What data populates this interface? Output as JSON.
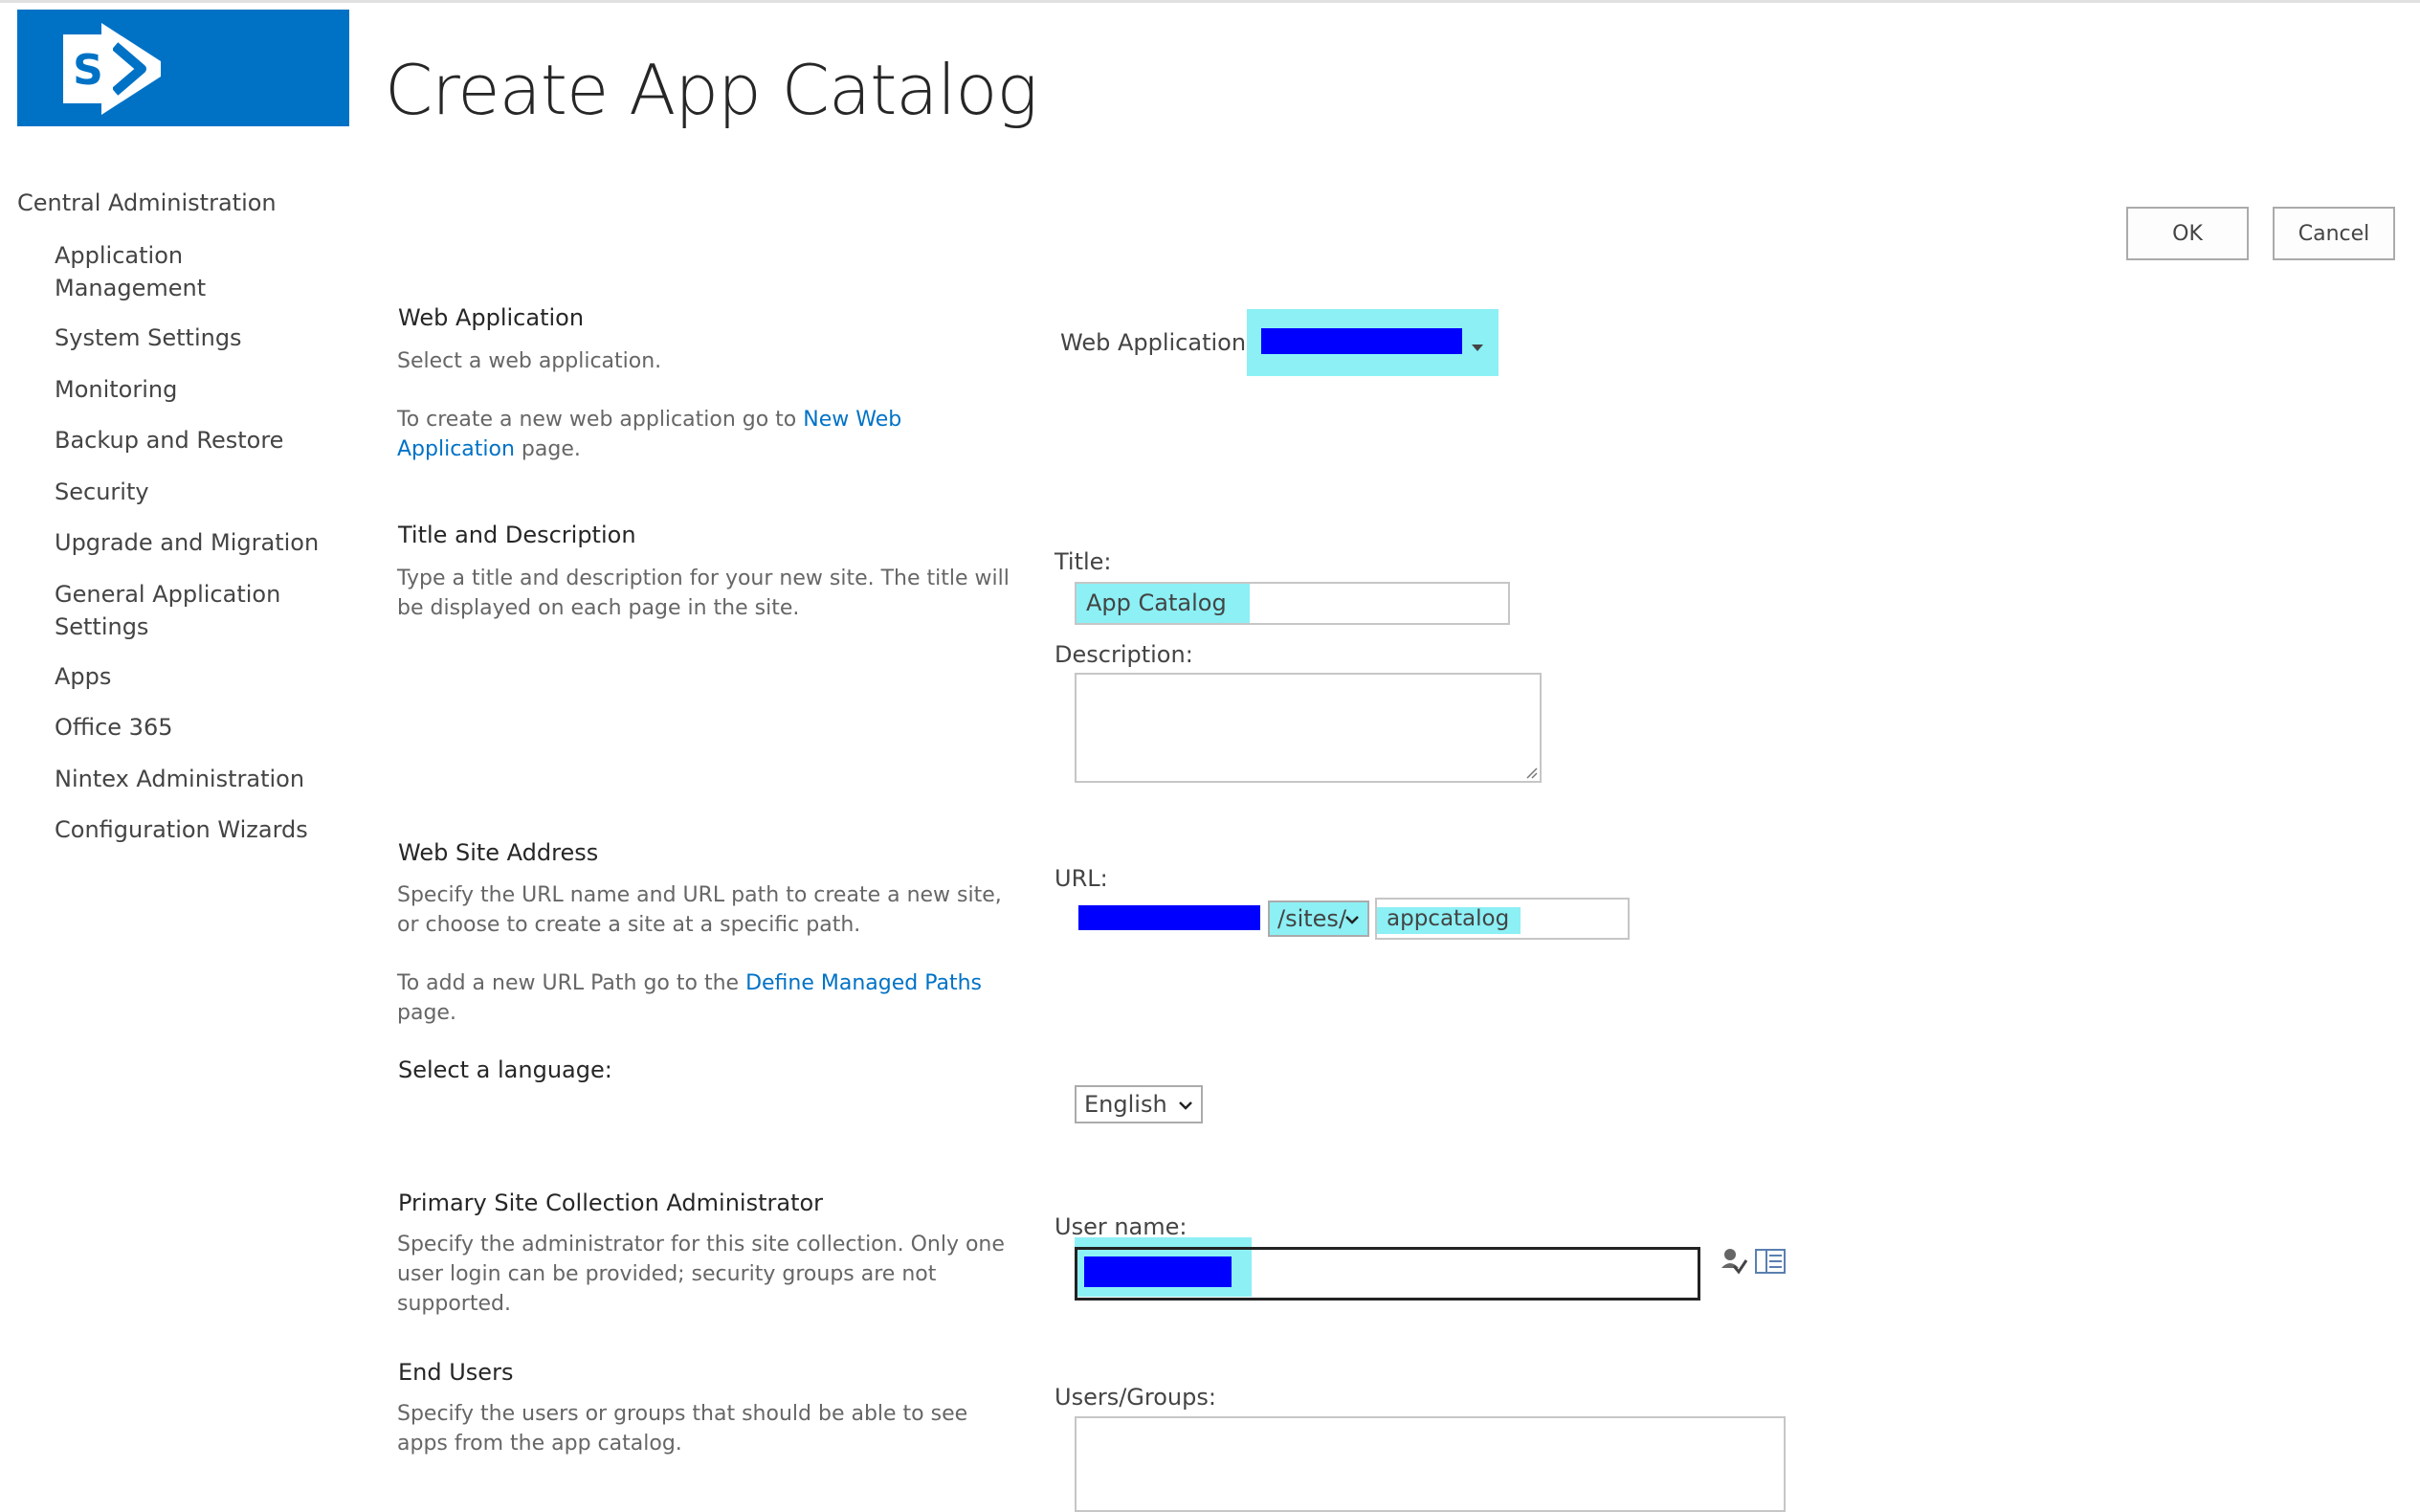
{
  "page": {
    "title": "Create App Catalog"
  },
  "nav": {
    "root": "Central Administration",
    "items": [
      "Application Management",
      "System Settings",
      "Monitoring",
      "Backup and Restore",
      "Security",
      "Upgrade and Migration",
      "General Application Settings",
      "Apps",
      "Office 365",
      "Nintex Administration",
      "Configuration Wizards"
    ]
  },
  "buttons": {
    "ok": "OK",
    "cancel": "Cancel"
  },
  "sections": {
    "web_application": {
      "heading": "Web Application",
      "desc": "Select a web application.",
      "desc2_prefix": "To create a new web application go to ",
      "desc2_link": "New Web Application",
      "desc2_suffix": " page.",
      "field_label": "Web Application:"
    },
    "title_description": {
      "heading": "Title and Description",
      "desc": "Type a title and description for your new site. The title will be displayed on each page in the site.",
      "title_label": "Title:",
      "title_value": "App Catalog",
      "description_label": "Description:",
      "description_value": ""
    },
    "web_site_address": {
      "heading": "Web Site Address",
      "desc": "Specify the URL name and URL path to create a new site, or choose to create a site at a specific path.",
      "desc2_prefix": "To add a new URL Path go to the ",
      "desc2_link": "Define Managed Paths",
      "desc2_suffix": " page.",
      "url_label": "URL:",
      "path_value": "/sites/",
      "url_name_value": "appcatalog"
    },
    "language": {
      "heading": "Select a language:",
      "value": "English"
    },
    "primary_admin": {
      "heading": "Primary Site Collection Administrator",
      "desc": "Specify the administrator for this site collection. Only one user login can be provided; security groups are not supported.",
      "user_label": "User name:"
    },
    "end_users": {
      "heading": "End Users",
      "desc": "Specify the users or groups that should be able to see apps from the app catalog.",
      "users_label": "Users/Groups:"
    }
  },
  "icons": {
    "check_names": "check-names-icon",
    "browse": "address-book-icon"
  },
  "colors": {
    "accent": "#0072c6",
    "link": "#0072c6",
    "highlight": "#8cf0f5",
    "redaction": "#0000ff"
  }
}
